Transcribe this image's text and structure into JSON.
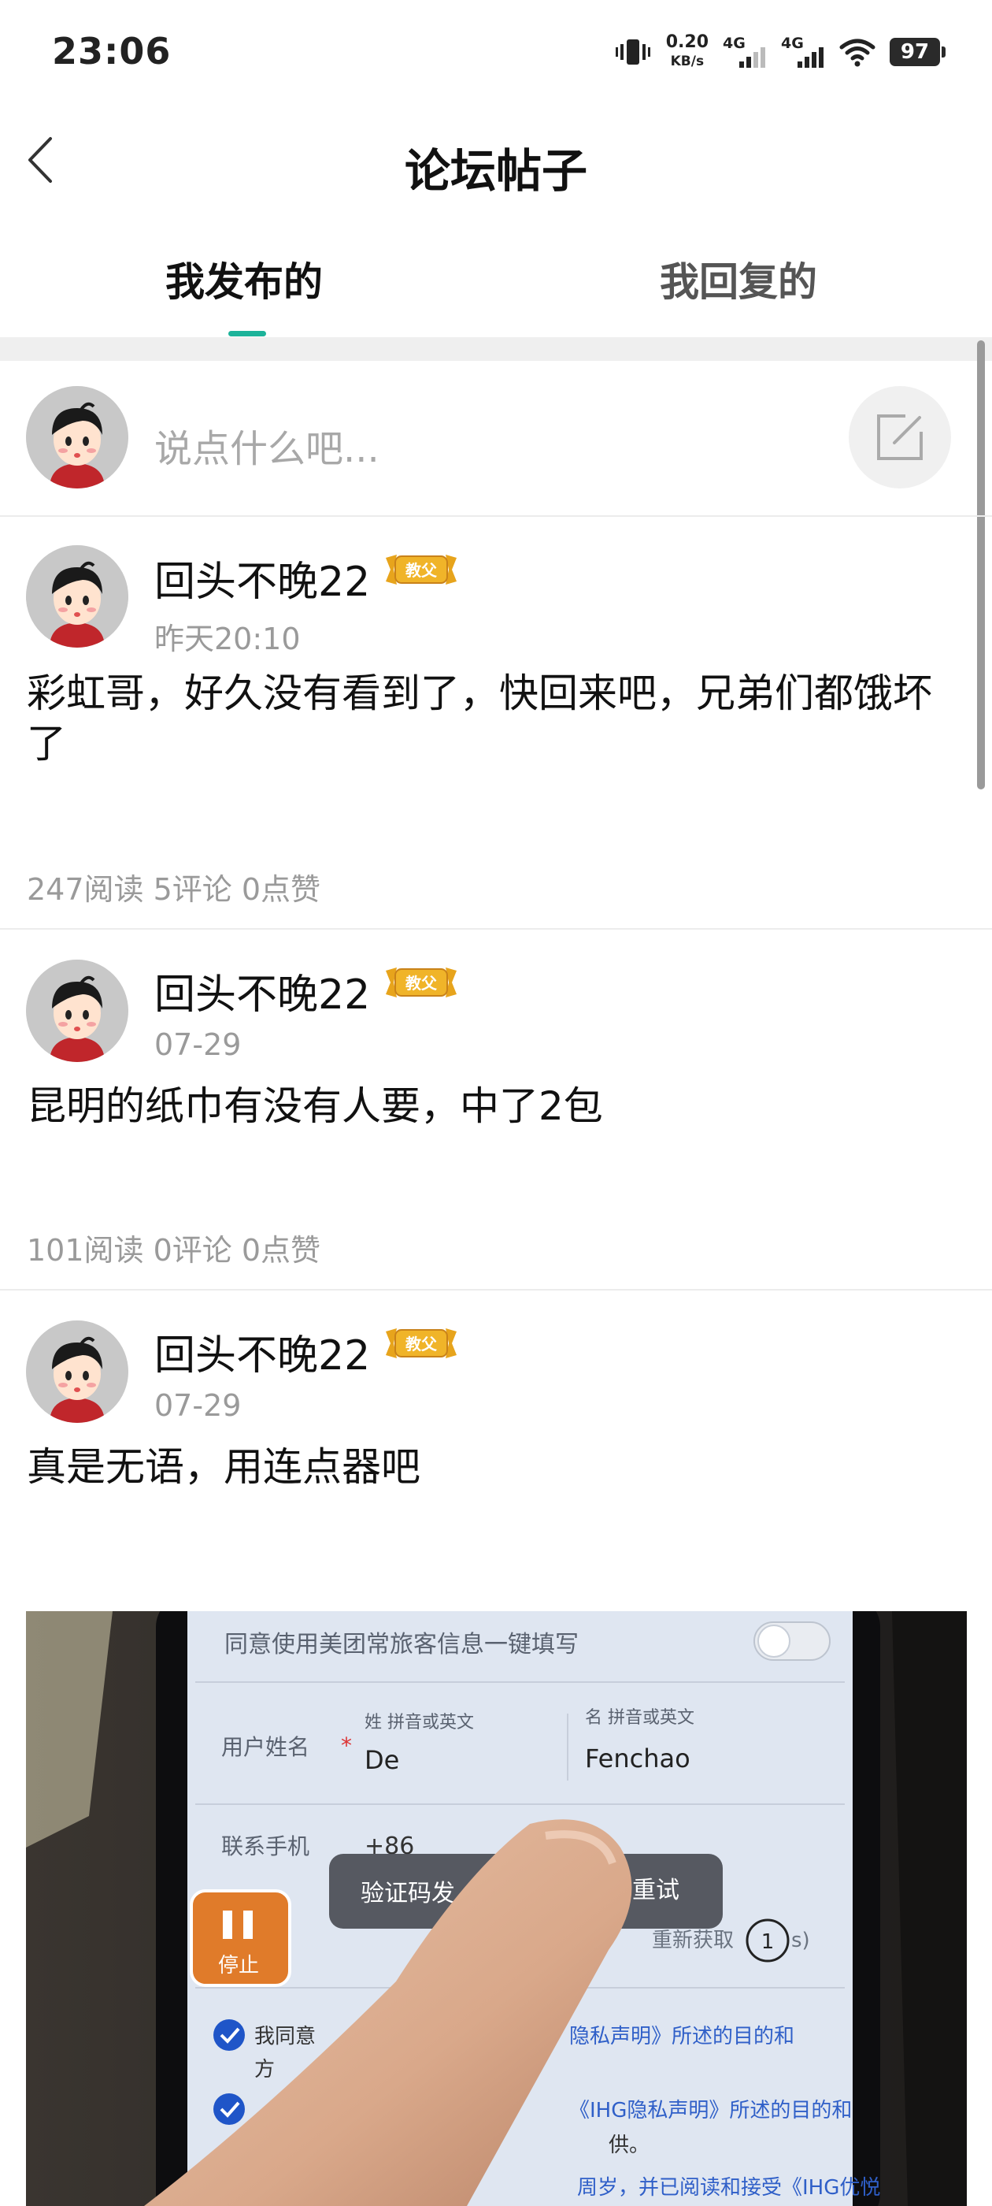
{
  "status_bar": {
    "time": "23:06",
    "net_speed_value": "0.20",
    "net_speed_unit": "KB/s",
    "sim1_label": "4G",
    "sim2_label": "4G",
    "battery": "97"
  },
  "header": {
    "title": "论坛帖子"
  },
  "tabs": [
    {
      "label": "我发布的",
      "active": true
    },
    {
      "label": "我回复的",
      "active": false
    }
  ],
  "composer": {
    "placeholder": "说点什么吧..."
  },
  "accent_color": "#1db39a",
  "posts": [
    {
      "username": "回头不晚22",
      "badge": "教父",
      "time": "昨天20:10",
      "content": "彩虹哥，好久没有看到了，快回来吧，兄弟们都饿坏了",
      "stats": "247阅读 5评论 0点赞"
    },
    {
      "username": "回头不晚22",
      "badge": "教父",
      "time": "07-29",
      "content": "昆明的纸巾有没有人要，中了2包",
      "stats": "101阅读 0评论 0点赞"
    },
    {
      "username": "回头不晚22",
      "badge": "教父",
      "time": "07-29",
      "content": "真是无语，用连点器吧"
    }
  ],
  "photo": {
    "row1": "同意使用美团常旅客信息一键填写",
    "surname_hint": "姓 拼音或英文",
    "given_hint": "名 拼音或英文",
    "name_label": "用户姓名",
    "surname_value": "De",
    "given_value": "Fenchao",
    "phone_label": "联系手机",
    "phone_prefix": "+86",
    "toast_left": "验证码发",
    "toast_right": "后重试",
    "resend": "重新获取",
    "countdown": "1",
    "countdown_unit": "s)",
    "stop_label": "停止",
    "consent1_a": "我同意",
    "consent1_b": "隐私声明》所述的目的和",
    "consent1_c": "方",
    "consent2_b": "《IHG隐私声明》所述的目的和",
    "consent2_c": "供。",
    "consent3": "周岁，并已阅读和接受《IHG优悦"
  }
}
